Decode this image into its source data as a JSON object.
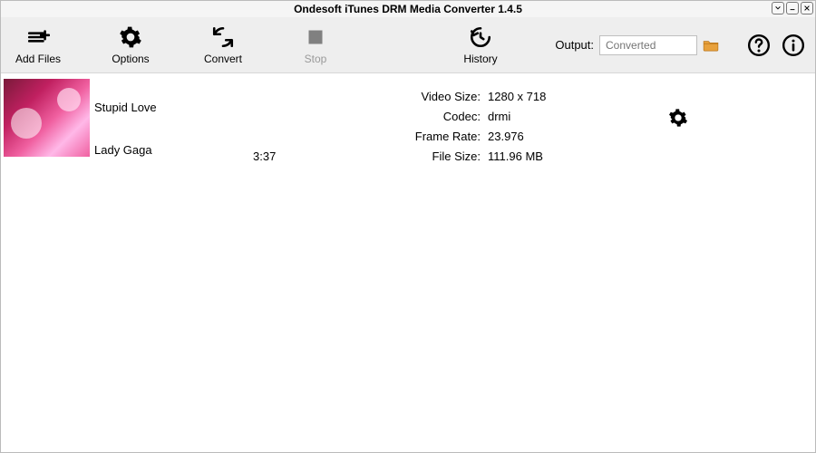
{
  "app": {
    "title": "Ondesoft iTunes DRM Media Converter 1.4.5"
  },
  "toolbar": {
    "addFiles": "Add Files",
    "options": "Options",
    "convert": "Convert",
    "stop": "Stop",
    "history": "History"
  },
  "output": {
    "label": "Output:",
    "placeholder": "Converted"
  },
  "item": {
    "title": "Stupid Love",
    "artist": "Lady Gaga",
    "duration": "3:37",
    "meta": {
      "videoSizeLabel": "Video Size:",
      "videoSize": "1280 x 718",
      "codecLabel": "Codec:",
      "codec": "drmi",
      "frameRateLabel": "Frame Rate:",
      "frameRate": "23.976",
      "fileSizeLabel": "File Size:",
      "fileSize": "111.96 MB"
    }
  }
}
